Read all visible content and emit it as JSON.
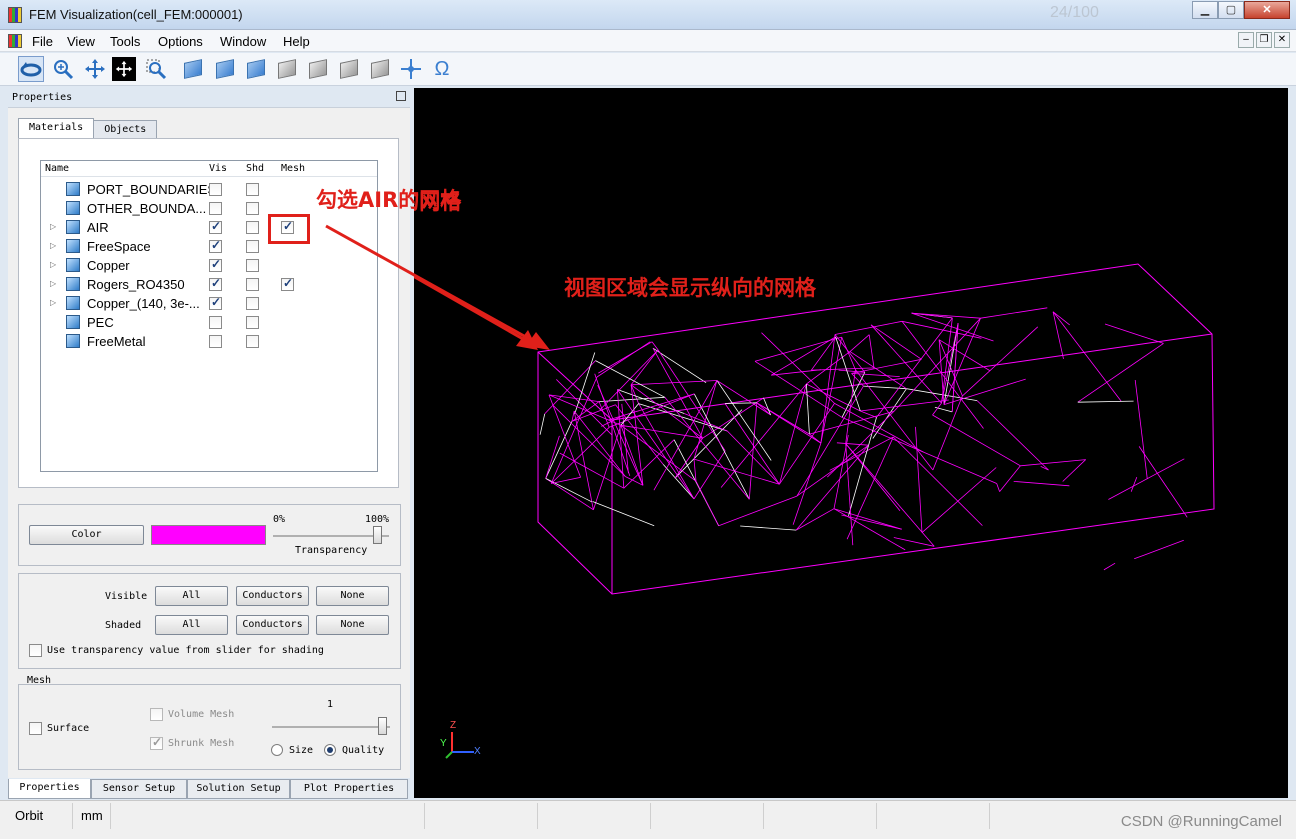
{
  "window": {
    "title": "FEM Visualization(cell_FEM:000001)",
    "ghost_text": "24/100"
  },
  "menu": [
    "File",
    "View",
    "Tools",
    "Options",
    "Window",
    "Help"
  ],
  "toolbar": {
    "icons": [
      "orbit-icon",
      "zoom-icon",
      "pan-icon",
      "move-icon",
      "zoom-box-icon",
      "view-front-icon",
      "view-back-icon",
      "view-top-icon",
      "view-bottom-icon",
      "view-left-icon",
      "view-right-icon",
      "view-iso-icon",
      "axis-origin-icon",
      "omega-icon"
    ]
  },
  "properties_title": "Properties",
  "tabs": {
    "materials": "Materials",
    "objects": "Objects"
  },
  "list": {
    "headers": {
      "name": "Name",
      "vis": "Vis",
      "shd": "Shd",
      "mesh": "Mesh"
    },
    "rows": [
      {
        "name": "PORT_BOUNDARIES",
        "expand": false,
        "vis": false,
        "shd": false,
        "mesh": null
      },
      {
        "name": "OTHER_BOUNDA...",
        "expand": false,
        "vis": false,
        "shd": false,
        "mesh": null
      },
      {
        "name": "AIR",
        "expand": true,
        "vis": true,
        "shd": false,
        "mesh": true
      },
      {
        "name": "FreeSpace",
        "expand": true,
        "vis": true,
        "shd": false,
        "mesh": null
      },
      {
        "name": "Copper",
        "expand": true,
        "vis": true,
        "shd": false,
        "mesh": null
      },
      {
        "name": "Rogers_RO4350",
        "expand": true,
        "vis": true,
        "shd": false,
        "mesh": true
      },
      {
        "name": "Copper_(140, 3e-...",
        "expand": true,
        "vis": true,
        "shd": false,
        "mesh": null
      },
      {
        "name": "PEC",
        "expand": false,
        "vis": false,
        "shd": false,
        "mesh": null
      },
      {
        "name": "FreeMetal",
        "expand": false,
        "vis": false,
        "shd": false,
        "mesh": null
      }
    ]
  },
  "color_group": {
    "color_button": "Color",
    "swatch_color": "#ff00ff",
    "min_label": "0%",
    "max_label": "100%",
    "slider_label": "Transparency",
    "transparency": 0.93
  },
  "visibility_group": {
    "visible_label": "Visible",
    "shaded_label": "Shaded",
    "all": "All",
    "conductors": "Conductors",
    "none": "None",
    "checkbox_label": "Use transparency value from slider for shading"
  },
  "mesh_group": {
    "title": "Mesh",
    "surface": "Surface",
    "volume_mesh": "Volume Mesh",
    "shrunk_mesh": "Shrunk Mesh",
    "slider_value": "1",
    "size": "Size",
    "quality": "Quality"
  },
  "bottom_tabs": [
    "Properties",
    "Sensor Setup",
    "Solution Setup",
    "Plot Properties"
  ],
  "annotations": {
    "check_air_mesh": "勾选AIR的网格",
    "view_shows_mesh": "视图区域会显示纵向的网格"
  },
  "axes": {
    "z": "Z",
    "y": "Y",
    "x": "X"
  },
  "status": {
    "mode": "Orbit",
    "units": "mm"
  },
  "watermark": "CSDN @RunningCamel"
}
